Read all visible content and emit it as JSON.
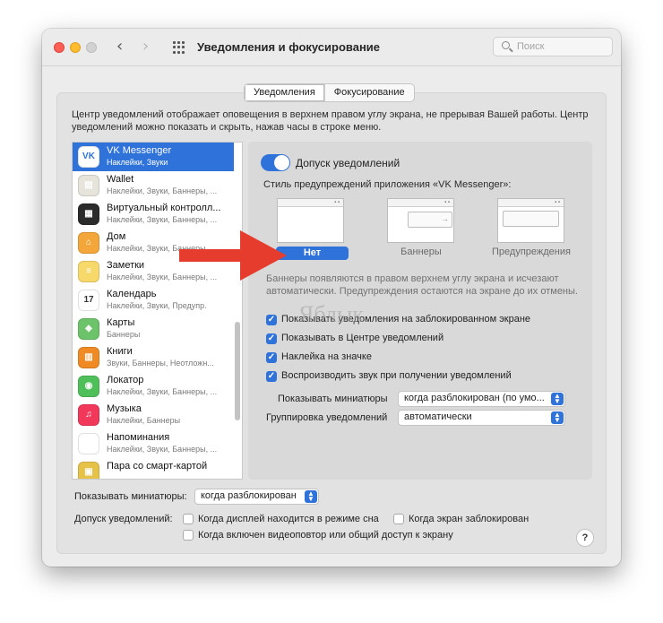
{
  "window": {
    "title": "Уведомления и фокусирование",
    "search_placeholder": "Поиск"
  },
  "tabs": [
    {
      "label": "Уведомления",
      "active": true
    },
    {
      "label": "Фокусирование",
      "active": false
    }
  ],
  "description": "Центр уведомлений отображает оповещения в верхнем правом углу экрана, не прерывая Вашей работы. Центр уведомлений можно показать и скрыть, нажав часы в строке меню.",
  "apps": [
    {
      "name": "VK Messenger",
      "sub": "Наклейки, Звуки",
      "icon": "vk-icon",
      "color": "#ffffff",
      "selected": true
    },
    {
      "name": "Wallet",
      "sub": "Наклейки, Звуки, Баннеры, ...",
      "icon": "wallet-icon",
      "color": "#e7e4dc"
    },
    {
      "name": "Виртуальный контролл...",
      "sub": "Наклейки, Звуки, Баннеры, ...",
      "icon": "game-controller-icon",
      "color": "#2b2b2b"
    },
    {
      "name": "Дом",
      "sub": "Наклейки, Звуки, Баннеры, ...",
      "icon": "home-icon",
      "color": "#f3a63a"
    },
    {
      "name": "Заметки",
      "sub": "Наклейки, Звуки, Баннеры, ...",
      "icon": "notes-icon",
      "color": "#f7d86a"
    },
    {
      "name": "Календарь",
      "sub": "Наклейки, Звуки, Предупр.",
      "icon": "calendar-icon",
      "color": "#ffffff"
    },
    {
      "name": "Карты",
      "sub": "Баннеры",
      "icon": "maps-icon",
      "color": "#6cc36a"
    },
    {
      "name": "Книги",
      "sub": "Звуки, Баннеры, Неотложн...",
      "icon": "books-icon",
      "color": "#f08a24"
    },
    {
      "name": "Локатор",
      "sub": "Наклейки, Звуки, Баннеры, ...",
      "icon": "find-my-icon",
      "color": "#4fbf5a"
    },
    {
      "name": "Музыка",
      "sub": "Наклейки, Баннеры",
      "icon": "music-icon",
      "color": "#f2385a"
    },
    {
      "name": "Напоминания",
      "sub": "Наклейки, Звуки, Баннеры, ...",
      "icon": "reminders-icon",
      "color": "#ffffff"
    },
    {
      "name": "Пара со смарт-картой",
      "sub": "",
      "icon": "smart-card-icon",
      "color": "#e7c248"
    }
  ],
  "detail": {
    "allow_label": "Допуск уведомлений",
    "allow_on": true,
    "style_label": "Стиль предупреждений приложения «VK Messenger»:",
    "styles": [
      {
        "label": "Нет",
        "selected": true
      },
      {
        "label": "Баннеры",
        "selected": false
      },
      {
        "label": "Предупреждения",
        "selected": false
      }
    ],
    "banner_desc": "Баннеры появляются в правом верхнем углу экрана и исчезают автоматически. Предупреждения остаются на экране до их отмены.",
    "checkboxes": [
      {
        "label": "Показывать уведомления на заблокированном экране",
        "checked": true
      },
      {
        "label": "Показывать в Центре уведомлений",
        "checked": true
      },
      {
        "label": "Наклейка на значке",
        "checked": true
      },
      {
        "label": "Воспроизводить звук при получении уведомлений",
        "checked": true
      }
    ],
    "previews_label": "Показывать миниатюры",
    "previews_value": "когда разблокирован (по умо...",
    "grouping_label": "Группировка уведомлений",
    "grouping_value": "автоматически"
  },
  "bottom": {
    "previews_label": "Показывать миниатюры:",
    "previews_value": "когда разблокирован",
    "allow_label": "Допуск уведомлений:",
    "opt_sleep": "Когда дисплей находится в режиме сна",
    "opt_locked": "Когда экран заблокирован",
    "opt_mirror": "Когда включен видеоповтор или общий доступ к экрану",
    "help": "?"
  },
  "watermark": "Яблык",
  "colors": {
    "accent": "#2f72d9",
    "arrow": "#e53c2e"
  }
}
